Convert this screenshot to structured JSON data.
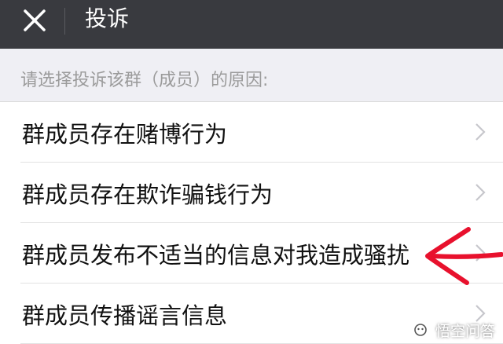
{
  "header": {
    "title": "投诉",
    "close_icon": "close-icon"
  },
  "prompt": "请选择投诉该群（成员）的原因:",
  "reasons": [
    {
      "label": "群成员存在赌博行为"
    },
    {
      "label": "群成员存在欺诈骗钱行为"
    },
    {
      "label": "群成员发布不适当的信息对我造成骚扰"
    },
    {
      "label": "群成员传播谣言信息"
    }
  ],
  "watermark": {
    "text": "悟空问答"
  },
  "colors": {
    "topbar": "#393a3f",
    "background": "#efeff4",
    "annotation": "#e8112d"
  }
}
